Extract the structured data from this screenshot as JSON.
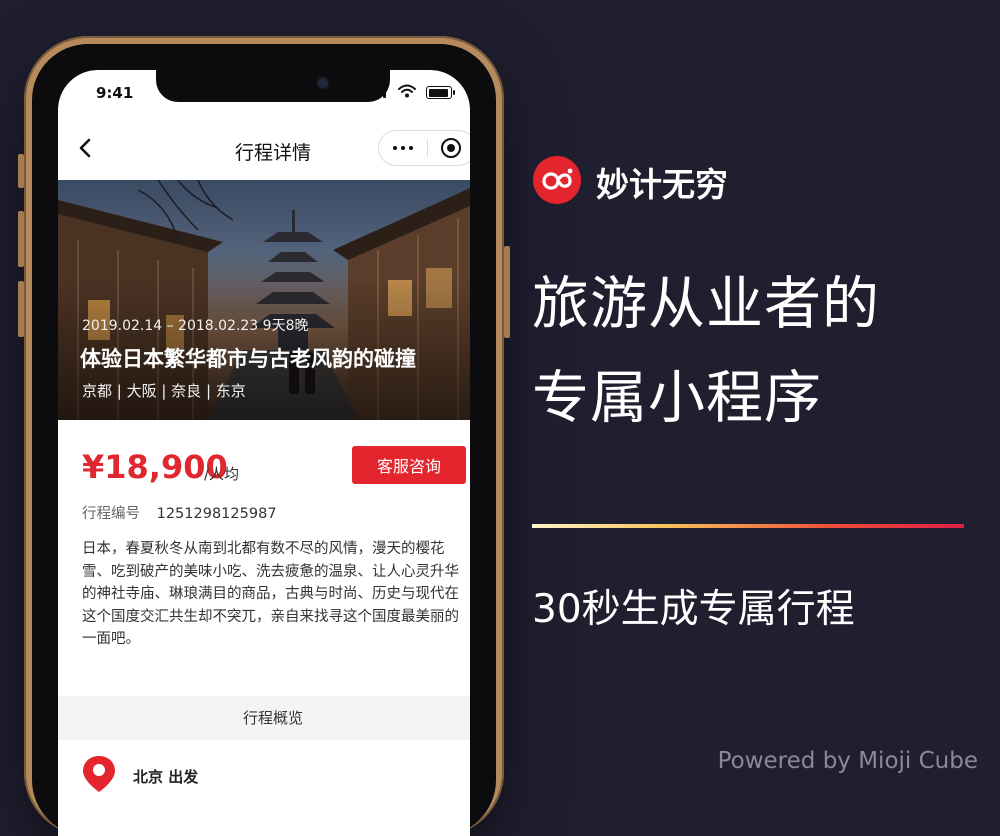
{
  "phone": {
    "status_time": "9:41",
    "nav_title": "行程详情",
    "hero": {
      "dates": "2019.02.14 – 2018.02.23  9天8晚",
      "title": "体验日本繁华都市与古老风韵的碰撞",
      "cities": "京都 | 大阪 | 奈良 | 东京"
    },
    "price": "¥18,900",
    "price_unit": "/人均",
    "consult_button": "客服咨询",
    "code_label": "行程编号",
    "code_value": "1251298125987",
    "description": "日本，春夏秋冬从南到北都有数不尽的风情，漫天的樱花雪、吃到破产的美味小吃、洗去疲惫的温泉、让人心灵升华的神社寺庙、琳琅满目的商品，古典与时尚、历史与现代在这个国度交汇共生却不突兀，亲自来找寻这个国度最美丽的一面吧。",
    "overview_label": "行程概览",
    "departure": "北京 出发"
  },
  "promo": {
    "brand_name": "妙计无穷",
    "headline_line1": "旅游从业者的",
    "headline_line2": "专属小程序",
    "tagline": "30秒生成专属行程",
    "powered_by": "Powered by Mioji Cube"
  },
  "colors": {
    "background": "#1f1f30",
    "accent_red": "#e5252e",
    "phone_frame": "#b68a5c"
  }
}
